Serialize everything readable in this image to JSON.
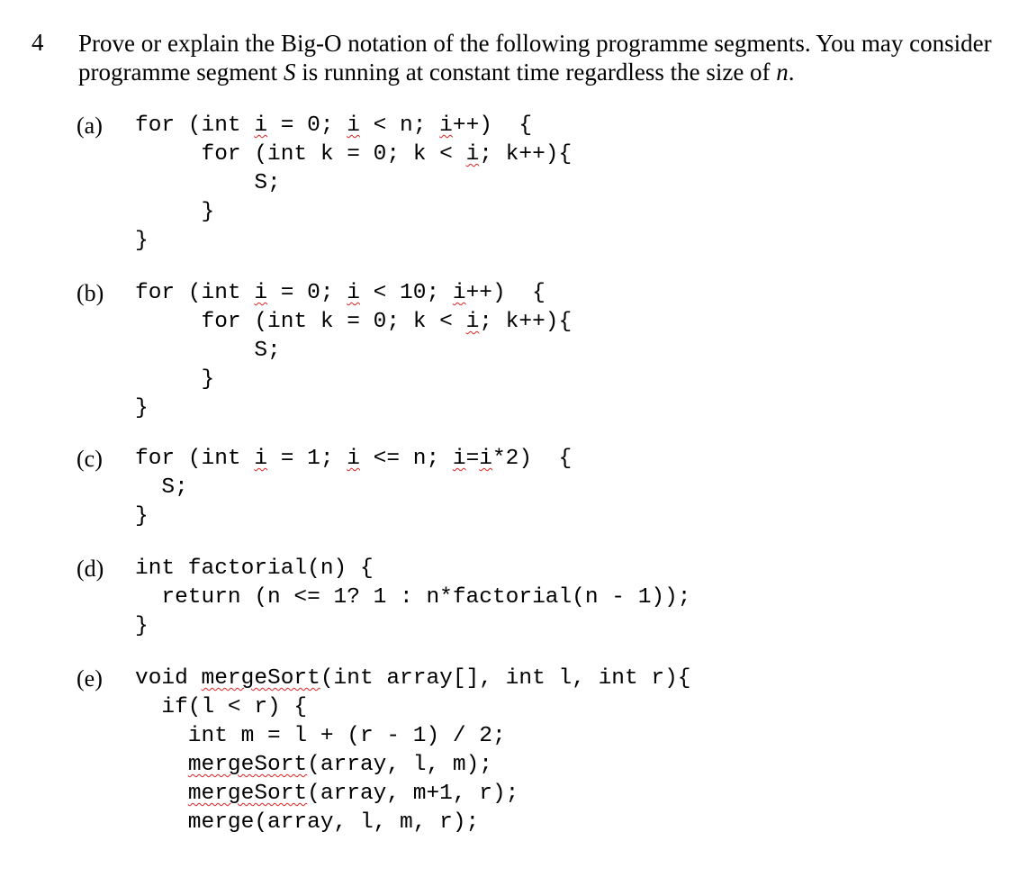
{
  "question": {
    "number": "4",
    "text_before_S": "Prove or explain the Big-O notation of the following programme segments.  You may consider programme segment ",
    "S": "S",
    "text_mid": " is running at constant time regardless the size of ",
    "n": "n",
    "text_end": "."
  },
  "parts": [
    {
      "label": "(a)",
      "lines": [
        [
          [
            "for (int ",
            ""
          ],
          [
            "i",
            "sq"
          ],
          [
            " = 0; ",
            ""
          ],
          [
            "i",
            "sq"
          ],
          [
            " < n; ",
            ""
          ],
          [
            "i",
            "sq"
          ],
          [
            "++)  {",
            ""
          ]
        ],
        [
          [
            "     for (int k = 0; k < ",
            ""
          ],
          [
            "i",
            "sq"
          ],
          [
            "; k++){",
            ""
          ]
        ],
        [
          [
            "         S;",
            ""
          ]
        ],
        [
          [
            "     }",
            ""
          ]
        ],
        [
          [
            "}",
            ""
          ]
        ]
      ]
    },
    {
      "label": "(b)",
      "lines": [
        [
          [
            "for (int ",
            ""
          ],
          [
            "i",
            "sq"
          ],
          [
            " = 0; ",
            ""
          ],
          [
            "i",
            "sq"
          ],
          [
            " < 10; ",
            ""
          ],
          [
            "i",
            "sq"
          ],
          [
            "++)  {",
            ""
          ]
        ],
        [
          [
            "     for (int k = 0; k < ",
            ""
          ],
          [
            "i",
            "sq"
          ],
          [
            "; k++){",
            ""
          ]
        ],
        [
          [
            "         S;",
            ""
          ]
        ],
        [
          [
            "     }",
            ""
          ]
        ],
        [
          [
            "}",
            ""
          ]
        ]
      ]
    },
    {
      "label": "(c)",
      "lines": [
        [
          [
            "for (int ",
            ""
          ],
          [
            "i",
            "sq"
          ],
          [
            " = 1; ",
            ""
          ],
          [
            "i",
            "sq"
          ],
          [
            " <= n; ",
            ""
          ],
          [
            "i",
            "sq"
          ],
          [
            "=",
            ""
          ],
          [
            "i",
            "sq"
          ],
          [
            "*2)  {",
            ""
          ]
        ],
        [
          [
            "  S;",
            ""
          ]
        ],
        [
          [
            "}",
            ""
          ]
        ]
      ]
    },
    {
      "label": "(d)",
      "lines": [
        [
          [
            "int factorial(n) {",
            ""
          ]
        ],
        [
          [
            "  return (n <= 1? 1 : n*factorial(n - 1));",
            ""
          ]
        ],
        [
          [
            "}",
            ""
          ]
        ]
      ]
    },
    {
      "label": "(e)",
      "lines": [
        [
          [
            "void ",
            ""
          ],
          [
            "mergeSort",
            "sq"
          ],
          [
            "(int array[], int l, int r){",
            ""
          ]
        ],
        [
          [
            "  if(l < r) {",
            ""
          ]
        ],
        [
          [
            "    int m = l + (r - 1) / 2;",
            ""
          ]
        ],
        [
          [
            "    ",
            ""
          ],
          [
            "mergeSort",
            "sq"
          ],
          [
            "(array, l, m);",
            ""
          ]
        ],
        [
          [
            "    ",
            ""
          ],
          [
            "mergeSort",
            "sq"
          ],
          [
            "(array, m+1, r);",
            ""
          ]
        ],
        [
          [
            "    merge(array, l, m, r);",
            ""
          ]
        ]
      ]
    }
  ]
}
